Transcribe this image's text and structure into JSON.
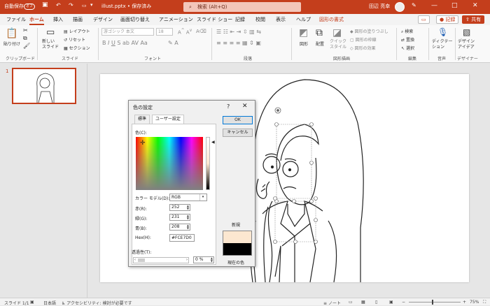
{
  "titlebar": {
    "autosave_label": "自動保存",
    "autosave_state": "オフ",
    "filename": "illust.pptx • 保存済み",
    "search_placeholder": "検索 (Alt+Q)",
    "username": "田辺 亮幸",
    "minimize": "—",
    "maximize": "□",
    "close": "✕"
  },
  "tabs": [
    "ファイル",
    "ホーム",
    "挿入",
    "描画",
    "デザイン",
    "画面切り替え",
    "アニメーション",
    "スライド ショー",
    "記録",
    "校閲",
    "表示",
    "ヘルプ",
    "図形の書式"
  ],
  "topright": {
    "record_label": "記録",
    "share_label": "共有"
  },
  "ribbon": {
    "paste": "貼り付け",
    "clipboard": "クリップボード",
    "new_slide": "新しい\nスライド",
    "layout": "レイアウト",
    "reset": "リセット",
    "section": "セクション",
    "slides": "スライド",
    "font_name": "游ゴシック 本文",
    "font_size": "18",
    "font": "フォント",
    "paragraph": "段落",
    "shapes": "図形",
    "arrange": "配置",
    "quick_styles": "クイック\nスタイル",
    "shape_fill": "図形の塗りつぶし",
    "shape_outline": "図形の枠線",
    "shape_effects": "図形の効果",
    "drawing": "図形描画",
    "find": "検索",
    "replace": "置換",
    "select": "選択",
    "editing": "編集",
    "dictate": "ディクテー\nション",
    "voice": "音声",
    "designer": "デザイン\nアイデア",
    "designer_grp": "デザイナー"
  },
  "thumbnail": {
    "number": "1"
  },
  "dialog": {
    "title": "色の設定",
    "help": "?",
    "close": "✕",
    "tab_standard": "標準",
    "tab_custom": "ユーザー設定",
    "ok": "OK",
    "cancel": "キャンセル",
    "color_label": "色(C):",
    "color_model_label": "カラー モデル(D):",
    "color_model_value": "RGB",
    "red_label": "赤(R):",
    "red": "252",
    "green_label": "緑(G):",
    "green": "231",
    "blue_label": "青(B):",
    "blue": "208",
    "hex_label": "Hex(H):",
    "hex": "#FCE7D0",
    "transparency_label": "透過性(T):",
    "transparency": "0 %",
    "new_label": "新規",
    "current_label": "現在の色",
    "new_color": "#FCE7D0",
    "current_color": "#000000"
  },
  "statusbar": {
    "slide": "スライド 1/1",
    "lang": "日本語",
    "accessibility": "アクセシビリティ: 検討が必要です",
    "notes": "ノート",
    "zoom": "75%"
  },
  "colors": {
    "accent": "#c43e1c"
  }
}
